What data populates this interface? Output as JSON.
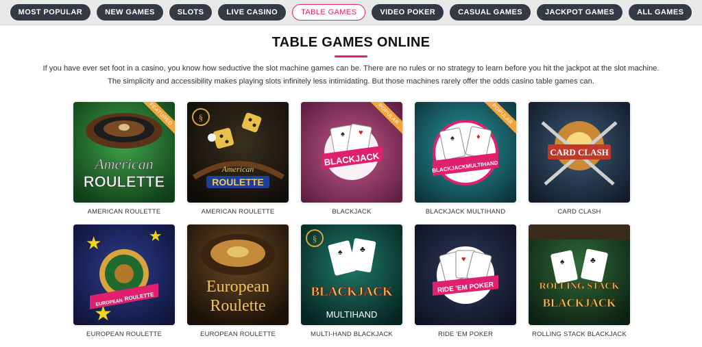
{
  "nav": {
    "items": [
      "MOST POPULAR",
      "NEW GAMES",
      "SLOTS",
      "LIVE CASINO",
      "TABLE GAMES",
      "VIDEO POKER",
      "CASUAL GAMES",
      "JACKPOT GAMES",
      "ALL GAMES"
    ],
    "active": "TABLE GAMES"
  },
  "page": {
    "title": "TABLE GAMES ONLINE",
    "intro": "If you have ever set foot in a casino, you know how seductive the slot machine games can be. There are no rules or no strategy to learn before you hit the jackpot at the slot machine. The simplicity and accessibility makes playing slots infinitely less intimidating. But those machines rarely offer the odds casino table games can."
  },
  "games": [
    {
      "caption": "AMERICAN ROULETTE",
      "badge": "FEATURED",
      "art_line1": "American",
      "art_line2": "ROULETTE"
    },
    {
      "caption": "AMERICAN ROULETTE",
      "badge": "",
      "art_line1": "American",
      "art_line2": "ROULETTE"
    },
    {
      "caption": "BLACKJACK",
      "badge": "POPULAR",
      "art_line1": "BLACKJACK",
      "art_line2": ""
    },
    {
      "caption": "BLACKJACK MULTIHAND",
      "badge": "POPULAR",
      "art_line1": "BLACKJACK",
      "art_line2": "MULTIHAND"
    },
    {
      "caption": "CARD CLASH",
      "badge": "",
      "art_line1": "CARD CLASH",
      "art_line2": ""
    },
    {
      "caption": "EUROPEAN ROULETTE",
      "badge": "",
      "art_line1": "EUROPEAN",
      "art_line2": "ROULETTE"
    },
    {
      "caption": "EUROPEAN ROULETTE",
      "badge": "",
      "art_line1": "European",
      "art_line2": "Roulette"
    },
    {
      "caption": "MULTI-HAND BLACKJACK",
      "badge": "",
      "art_line1": "BLACKJACK",
      "art_line2": "MULTIHAND"
    },
    {
      "caption": "RIDE 'EM POKER",
      "badge": "",
      "art_line1": "RIDE 'EM POKER",
      "art_line2": ""
    },
    {
      "caption": "ROLLING STACK BLACKJACK",
      "badge": "",
      "art_line1": "ROLLING STACK",
      "art_line2": "BLACKJACK"
    }
  ],
  "colors": {
    "accent": "#e0206e",
    "pill": "#333a45",
    "badge": "#f2a33a"
  }
}
